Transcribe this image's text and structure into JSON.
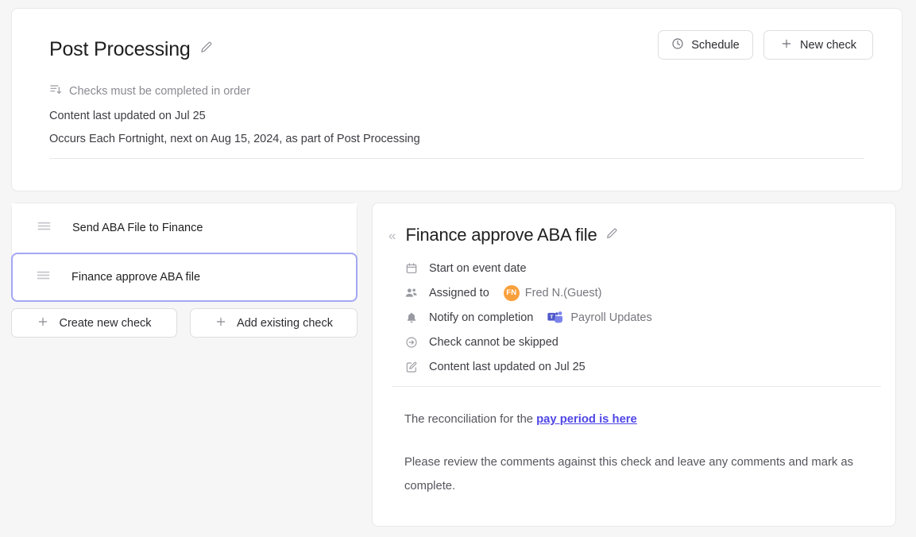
{
  "header": {
    "title": "Post Processing",
    "edit_icon": "pencil-icon",
    "order_note": "Checks must be completed in order",
    "order_icon": "sort-order-icon",
    "last_updated": "Content last updated on Jul 25",
    "occurrence": "Occurs Each Fortnight, next on Aug 15, 2024, as part of Post Processing",
    "buttons": {
      "schedule": {
        "label": "Schedule",
        "icon": "clock-icon"
      },
      "new_check": {
        "label": "New check",
        "icon": "plus-icon"
      }
    }
  },
  "checks_panel": {
    "items": [
      {
        "label": "Send ABA File to Finance",
        "icon": "drag-handle-icon",
        "selected": false
      },
      {
        "label": "Finance approve ABA file",
        "icon": "drag-handle-icon",
        "selected": true
      }
    ],
    "actions": [
      {
        "label": "Create new check",
        "icon": "plus-icon"
      },
      {
        "label": "Add existing check",
        "icon": "plus-icon"
      }
    ]
  },
  "detail": {
    "collapse_icon": "double-chevron-left-icon",
    "title": "Finance approve ABA file",
    "edit_icon": "pencil-icon",
    "meta": [
      {
        "icon": "calendar-icon",
        "label": "Start on event date",
        "value": ""
      },
      {
        "icon": "people-icon",
        "label": "Assigned to",
        "avatar_initials": "FN",
        "value": "Fred N.(Guest)"
      },
      {
        "icon": "bell-icon",
        "label": "Notify on completion",
        "badge_icon": "microsoft-teams-icon",
        "value": "Payroll Updates"
      },
      {
        "icon": "arrow-circle-right-icon",
        "label": "Check cannot be skipped",
        "value": ""
      },
      {
        "icon": "pencil-square-icon",
        "label": "Content last updated on Jul 25",
        "value": ""
      }
    ],
    "body": {
      "paragraph_1_prefix": "The reconciliation for the ",
      "paragraph_1_link": "pay period is here",
      "paragraph_2": "Please review the comments against this check and leave any comments and mark as complete."
    }
  },
  "colors": {
    "page_background": "#f6f6f7",
    "card_background": "#ffffff",
    "card_border": "#e8e8ea",
    "selection_border": "#a3a7f2",
    "avatar_orange": "#f9a03c",
    "link_violet": "#4f46e5",
    "teams_purple": "#5059c9",
    "teams_light_purple": "#7b83eb",
    "muted_text": "#8a8a92",
    "body_text": "#3c3c43"
  }
}
